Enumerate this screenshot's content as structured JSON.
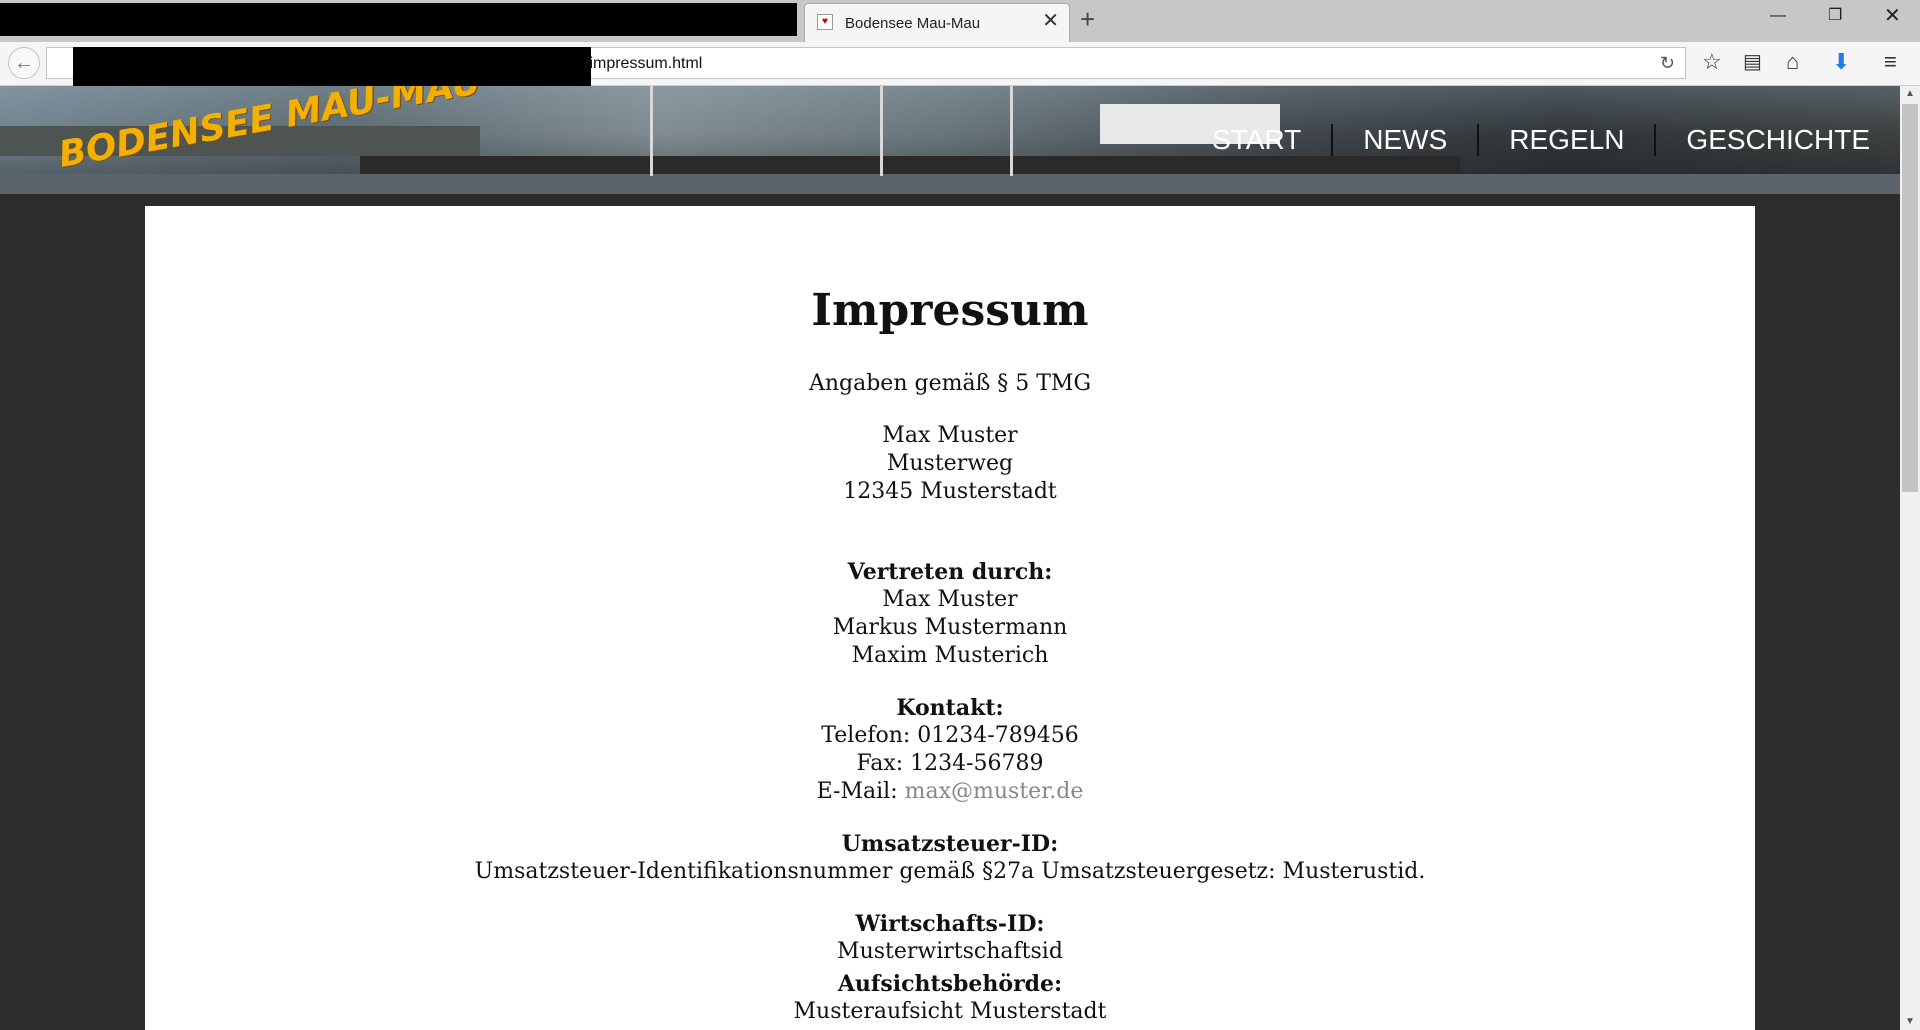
{
  "browser": {
    "tab_title": "Bodensee Mau-Mau",
    "url": "/impressum.html"
  },
  "header": {
    "logo": "BODENSEE MAU-MAU",
    "nav": [
      "START",
      "NEWS",
      "REGELN",
      "GESCHICHTE"
    ]
  },
  "page": {
    "title": "Impressum",
    "tmg": "Angaben gemäß § 5 TMG",
    "address": [
      "Max Muster",
      "Musterweg",
      "12345 Musterstadt"
    ],
    "represented_heading": "Vertreten durch:",
    "represented": [
      "Max Muster",
      "Markus Mustermann",
      "Maxim Musterich"
    ],
    "contact_heading": "Kontakt:",
    "phone": "Telefon: 01234-789456",
    "fax": "Fax: 1234-56789",
    "email_label": "E-Mail: ",
    "email": "max@muster.de",
    "vat_heading": "Umsatzsteuer-ID:",
    "vat_text": "Umsatzsteuer-Identifikationsnummer gemäß §27a Umsatzsteuergesetz: Musterustid.",
    "econ_heading": "Wirtschafts-ID:",
    "econ_text": "Musterwirtschaftsid",
    "authority_heading": "Aufsichtsbehörde:",
    "authority_text": "Musteraufsicht Musterstadt"
  }
}
